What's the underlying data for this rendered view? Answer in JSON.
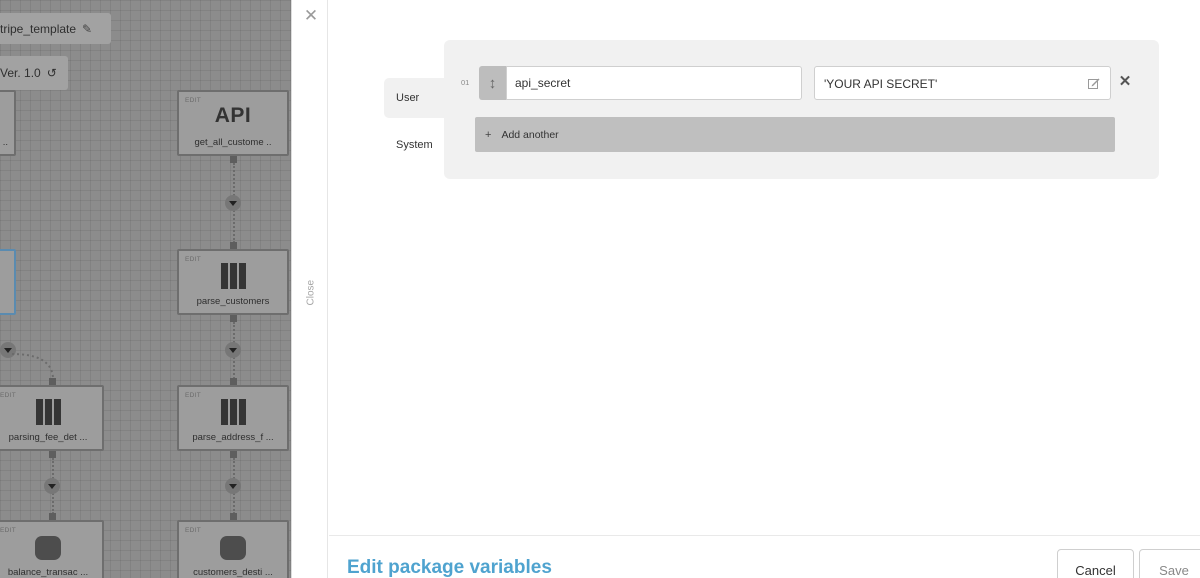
{
  "canvas": {
    "package_name": "tripe_template",
    "version": "Ver. 1.0",
    "edit_label": "EDIT",
    "nodes": [
      {
        "label": "get_all_custome ..",
        "glyph": "API"
      },
      {
        "label": "parse_customers"
      },
      {
        "label": "parsing_fee_det ..."
      },
      {
        "label": "parse_address_f ..."
      },
      {
        "label": "balance_transac ..."
      },
      {
        "label": "customers_desti ..."
      },
      {
        "label": ".."
      }
    ]
  },
  "close": {
    "label": "Close"
  },
  "tabs": [
    {
      "label": "User",
      "active": true
    },
    {
      "label": "System",
      "active": false
    }
  ],
  "variables": [
    {
      "index": "01",
      "name": "api_secret",
      "value": "'YOUR API SECRET'"
    }
  ],
  "add_another_label": "Add another",
  "footer": {
    "title": "Edit package variables",
    "cancel_label": "Cancel",
    "save_label": "Save",
    "title_color": "#4fa3cf"
  }
}
